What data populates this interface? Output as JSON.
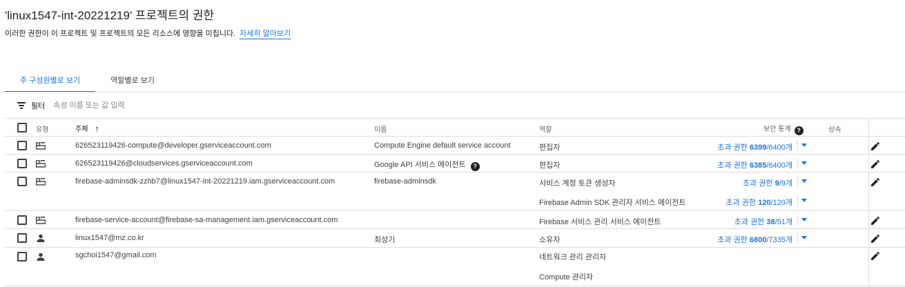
{
  "page": {
    "title": "'linux1547-int-20221219' 프로젝트의 권한",
    "description": "이러한 권한이 이 프로젝트 및 프로젝트의 모든 리소스에 영향을 미칩니다.",
    "learn_more": "자세히 알아보기"
  },
  "tabs": [
    {
      "label": "주 구성원별로 보기",
      "active": true
    },
    {
      "label": "역할별로 보기",
      "active": false
    }
  ],
  "filter": {
    "icon": "filter-list-icon",
    "label": "필터",
    "placeholder": "속성 이름 또는 값 입력"
  },
  "table": {
    "columns": {
      "type": "유형",
      "principal": "주체",
      "name": "이름",
      "role": "역할",
      "security_insights": "보안 통계",
      "inheritance": "상속"
    },
    "sort": {
      "column": "principal",
      "direction": "ascending"
    },
    "rows": [
      {
        "type_icon": "service-account-icon",
        "principal": "626523119426-compute@developer.gserviceaccount.com",
        "name": "Compute Engine default service account",
        "name_help": false,
        "roles": [
          {
            "role": "편집자",
            "stat_prefix": "초과 권한 ",
            "stat_value": "6399",
            "stat_total": "/6400개"
          }
        ]
      },
      {
        "type_icon": "service-account-icon",
        "principal": "626523119426@cloudservices.gserviceaccount.com",
        "name": "Google API 서비스 에이전트",
        "name_help": true,
        "roles": [
          {
            "role": "편집자",
            "stat_prefix": "초과 권한 ",
            "stat_value": "6385",
            "stat_total": "/6400개"
          }
        ]
      },
      {
        "type_icon": "service-account-icon",
        "principal": "firebase-adminsdk-zzhb7@linux1547-int-20221219.iam.gserviceaccount.com",
        "name": "firebase-adminsdk",
        "name_help": false,
        "roles": [
          {
            "role": "서비스 계정 토큰 생성자",
            "stat_prefix": "초과 권한 ",
            "stat_value": "9",
            "stat_total": "/9개"
          },
          {
            "role": "Firebase Admin SDK 관리자 서비스 에이전트",
            "stat_prefix": "초과 권한 ",
            "stat_value": "120",
            "stat_total": "/120개"
          }
        ]
      },
      {
        "type_icon": "service-account-icon",
        "principal": "firebase-service-account@firebase-sa-management.iam.gserviceaccount.com",
        "name": "",
        "name_help": false,
        "roles": [
          {
            "role": "Firebase 서비스 관리 서비스 에이전트",
            "stat_prefix": "초과 권한 ",
            "stat_value": "38",
            "stat_total": "/51개"
          }
        ]
      },
      {
        "type_icon": "person-icon",
        "principal": "linux1547@mz.co.kr",
        "name": "최성기",
        "name_help": false,
        "roles": [
          {
            "role": "소유자",
            "stat_prefix": "초과 권한 ",
            "stat_value": "6800",
            "stat_total": "/7335개"
          }
        ]
      },
      {
        "type_icon": "person-icon",
        "principal": "sgchoi1547@gmail.com",
        "name": "",
        "name_help": false,
        "roles": [
          {
            "role": "네트워크 관리 관리자",
            "stat_prefix": "",
            "stat_value": "",
            "stat_total": ""
          },
          {
            "role": "Compute 관리자",
            "stat_prefix": "",
            "stat_value": "",
            "stat_total": ""
          }
        ]
      }
    ]
  },
  "colors": {
    "accent": "#1a73e8",
    "border": "#dadce0",
    "text": "#202124",
    "muted": "#5f6368"
  }
}
